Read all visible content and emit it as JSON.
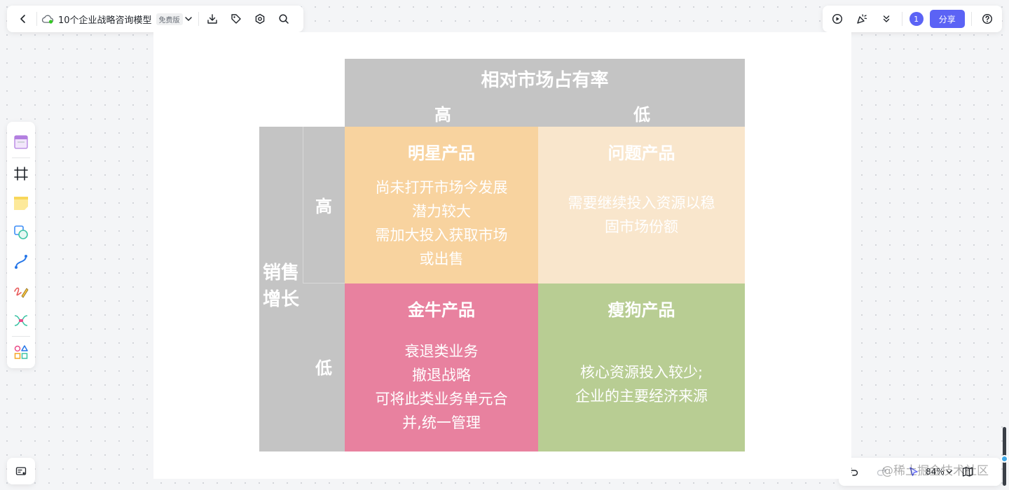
{
  "header": {
    "doc_title": "10个企业战略咨询模型",
    "plan_badge": "免费版",
    "collaborator_count": "1",
    "share_label": "分享"
  },
  "matrix": {
    "top_header": {
      "title": "相对市场占有率",
      "high": "高",
      "low": "低"
    },
    "left_header": {
      "axis_label_line1": "销售",
      "axis_label_line2": "增长",
      "high": "高",
      "low": "低"
    },
    "quadrants": {
      "star": {
        "title": "明星产品",
        "lines": [
          "尚未打开市场今发展",
          "潜力较大",
          "需加大投入获取市场",
          "或出售"
        ]
      },
      "question": {
        "title": "问题产品",
        "lines": [
          "需要继续投入资源以稳",
          "固市场份额"
        ]
      },
      "cash_cow": {
        "title": "金牛产品",
        "lines": [
          "衰退类业务",
          "撤退战略",
          "可将此类业务单元合",
          "并,统一管理"
        ]
      },
      "dog": {
        "title": "瘦狗产品",
        "lines": [
          "核心资源投入较少;",
          "企业的主要经济来源"
        ]
      }
    },
    "colors": {
      "header_gray": "#c4c4c4",
      "star": "#f8d39f",
      "question": "#f9e6cc",
      "cash_cow": "#e8819f",
      "dog": "#b8cd93"
    }
  },
  "footer": {
    "zoom": "84%",
    "watermark": "@稀土掘金技术社区"
  }
}
